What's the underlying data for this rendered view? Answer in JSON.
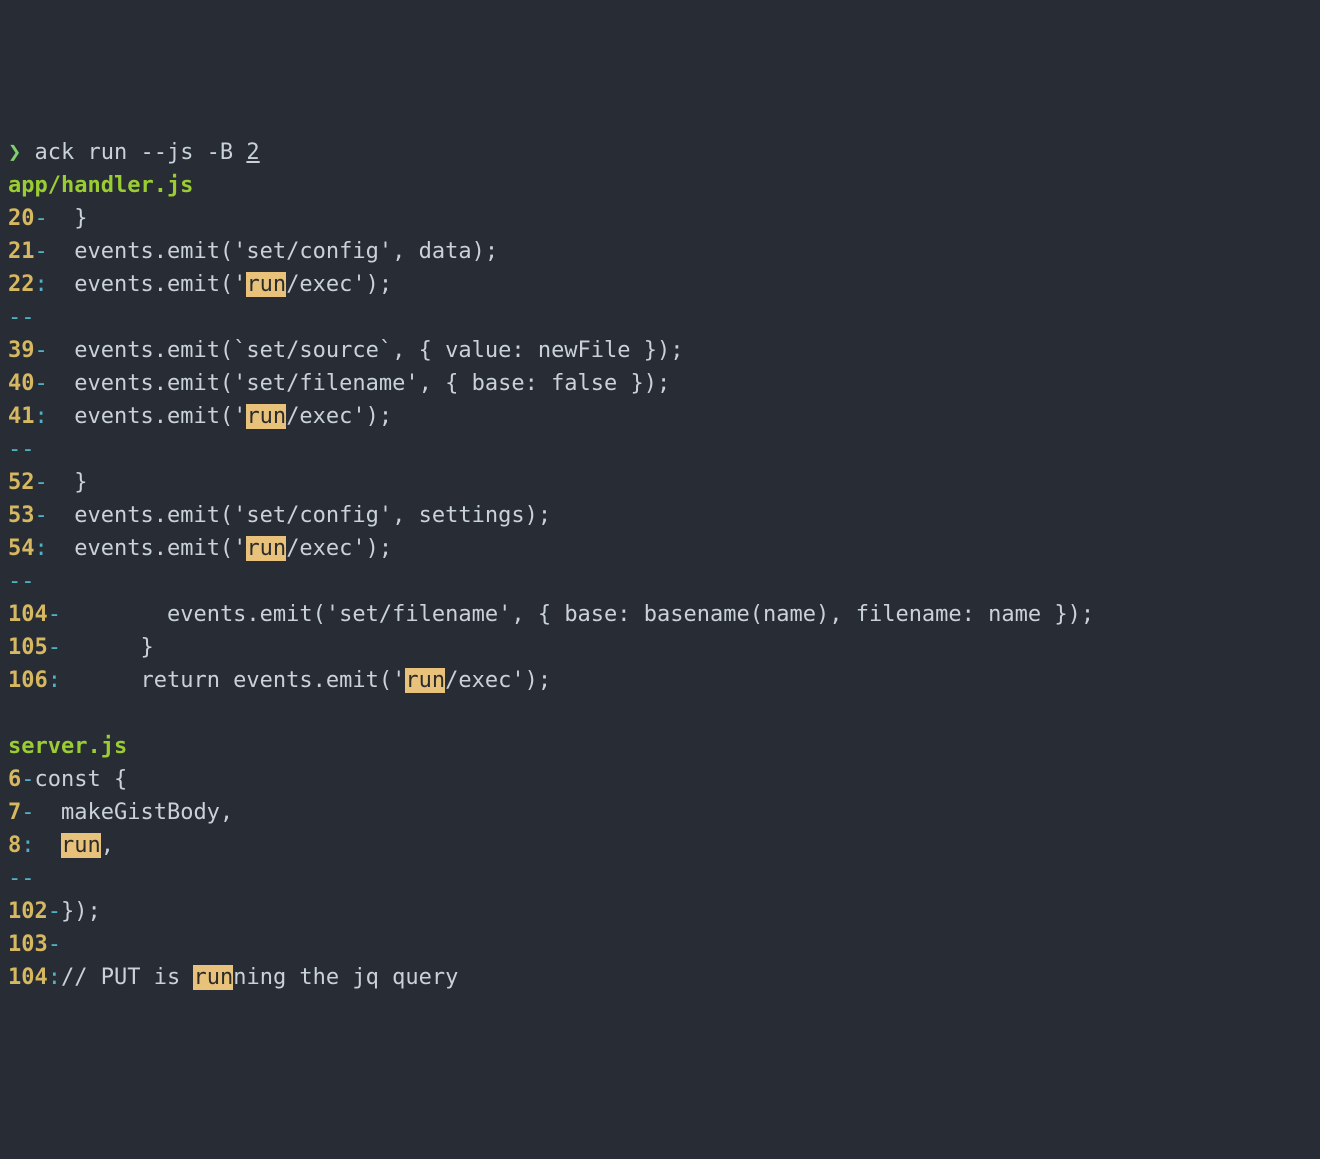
{
  "prompt": {
    "caret": "❯",
    "command_pre": " ack run --js -B ",
    "command_arg": "2"
  },
  "files": [
    {
      "name": "app/handler.js",
      "blocks": [
        {
          "lines": [
            {
              "no": "20",
              "sep": "-",
              "pre": "  }",
              "hl": "",
              "post": ""
            },
            {
              "no": "21",
              "sep": "-",
              "pre": "  events.emit('set/config', data);",
              "hl": "",
              "post": ""
            },
            {
              "no": "22",
              "sep": ":",
              "pre": "  events.emit('",
              "hl": "run",
              "post": "/exec');"
            }
          ]
        },
        {
          "lines": [
            {
              "no": "39",
              "sep": "-",
              "pre": "  events.emit(`set/source`, { value: newFile });",
              "hl": "",
              "post": ""
            },
            {
              "no": "40",
              "sep": "-",
              "pre": "  events.emit('set/filename', { base: false });",
              "hl": "",
              "post": ""
            },
            {
              "no": "41",
              "sep": ":",
              "pre": "  events.emit('",
              "hl": "run",
              "post": "/exec');"
            }
          ]
        },
        {
          "lines": [
            {
              "no": "52",
              "sep": "-",
              "pre": "  }",
              "hl": "",
              "post": ""
            },
            {
              "no": "53",
              "sep": "-",
              "pre": "  events.emit('set/config', settings);",
              "hl": "",
              "post": ""
            },
            {
              "no": "54",
              "sep": ":",
              "pre": "  events.emit('",
              "hl": "run",
              "post": "/exec');"
            }
          ]
        },
        {
          "lines": [
            {
              "no": "104",
              "sep": "-",
              "pre": "        events.emit('set/filename', { base: basename(name), filename: name });",
              "hl": "",
              "post": ""
            },
            {
              "no": "105",
              "sep": "-",
              "pre": "      }",
              "hl": "",
              "post": ""
            },
            {
              "no": "106",
              "sep": ":",
              "pre": "      return events.emit('",
              "hl": "run",
              "post": "/exec');"
            }
          ]
        }
      ]
    },
    {
      "name": "server.js",
      "blocks": [
        {
          "lines": [
            {
              "no": "6",
              "sep": "-",
              "pre": "const {",
              "hl": "",
              "post": ""
            },
            {
              "no": "7",
              "sep": "-",
              "pre": "  makeGistBody,",
              "hl": "",
              "post": ""
            },
            {
              "no": "8",
              "sep": ":",
              "pre": "  ",
              "hl": "run",
              "post": ","
            }
          ]
        },
        {
          "lines": [
            {
              "no": "102",
              "sep": "-",
              "pre": "});",
              "hl": "",
              "post": ""
            },
            {
              "no": "103",
              "sep": "-",
              "pre": "",
              "hl": "",
              "post": ""
            },
            {
              "no": "104",
              "sep": ":",
              "pre": "// PUT is ",
              "hl": "run",
              "post": "ning the jq query"
            }
          ]
        }
      ]
    }
  ],
  "context_separator": "--"
}
